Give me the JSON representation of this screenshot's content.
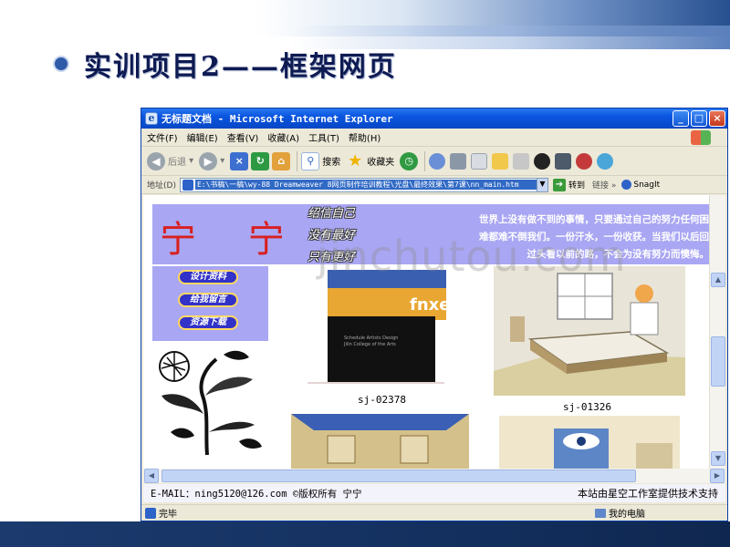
{
  "slide": {
    "title": "实训项目2——框架网页"
  },
  "window": {
    "title": "无标题文档 - Microsoft Internet Explorer"
  },
  "menu": {
    "items": [
      "文件(F)",
      "编辑(E)",
      "查看(V)",
      "收藏(A)",
      "工具(T)",
      "帮助(H)"
    ]
  },
  "toolbar": {
    "back_label": "后退",
    "search_label": "搜索",
    "favorites_label": "收藏夹"
  },
  "address": {
    "label": "地址(D)",
    "value": "E:\\书稿\\一稿\\wy-88 Dreamweaver 8网页制作培训教程\\光盘\\最终效果\\第7课\\nn_main.htm",
    "go_label": "转到",
    "links_label": "链接",
    "snagit_label": "SnagIt"
  },
  "page": {
    "site_name": "宁 宁",
    "mottos": [
      "绍信自己",
      "没有最好",
      "只有更好"
    ],
    "quote": "世界上没有做不到的事情，只要通过自己的努力任何困难都难不倒我们。一份汗水，一份收获。当我们以后回过头看以前的路，不会为没有努力而懊悔。",
    "nav": [
      "设计资料",
      "给我留言",
      "资源下载"
    ],
    "thumbs": [
      {
        "caption": "sj-02378"
      },
      {
        "caption": "sj-01326"
      }
    ],
    "thumb_card_text": "fnxe",
    "footer_left": "E-MAIL：ning5120@126.com  ©版权所有 宁宁",
    "footer_right": "本站由星空工作室提供技术支持"
  },
  "status": {
    "left": "完毕",
    "right": "我的电脑"
  },
  "watermark": "jinchutou.com",
  "colors": {
    "banner_bg": "#a9a6f3",
    "site_name": "#d82020",
    "nav_button": "#3232c8",
    "xp_titlebar": "#0a55e0"
  }
}
